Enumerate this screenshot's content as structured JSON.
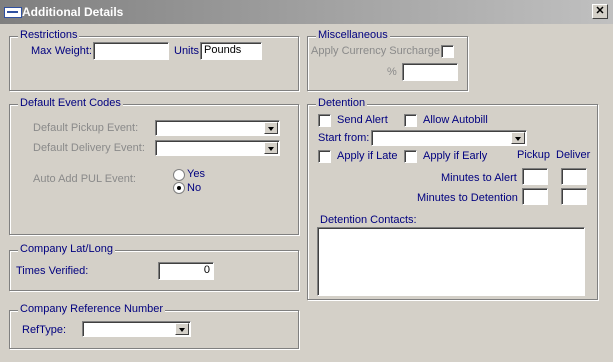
{
  "window": {
    "title": "Additional Details",
    "close_glyph": "✕"
  },
  "restrictions": {
    "legend": "Restrictions",
    "max_weight_label": "Max Weight:",
    "max_weight_value": "",
    "units_label": "Units:",
    "units_value": "Pounds"
  },
  "miscellaneous": {
    "legend": "Miscellaneous",
    "apply_currency_label": "Apply Currency Surcharge",
    "percent_label": "%",
    "percent_value": ""
  },
  "default_event_codes": {
    "legend": "Default Event Codes",
    "pickup_label": "Default Pickup Event:",
    "pickup_value": "",
    "delivery_label": "Default Delivery Event:",
    "delivery_value": "",
    "auto_add_label": "Auto Add PUL Event:",
    "yes_label": "Yes",
    "no_label": "No",
    "selected": "No"
  },
  "detention": {
    "legend": "Detention",
    "send_alert_label": "Send Alert",
    "allow_autobill_label": "Allow Autobill",
    "start_from_label": "Start from:",
    "start_from_value": "",
    "apply_if_late_label": "Apply if Late",
    "apply_if_early_label": "Apply if Early",
    "pickup_col": "Pickup",
    "delivery_col": "Deliver",
    "minutes_to_alert_label": "Minutes to Alert",
    "minutes_to_detention_label": "Minutes to Detention",
    "contacts_label": "Detention Contacts:"
  },
  "company_latlong": {
    "legend": "Company Lat/Long",
    "times_verified_label": "Times Verified:",
    "times_verified_value": "0"
  },
  "company_ref": {
    "legend": "Company Reference Number",
    "reftype_label": "RefType:",
    "reftype_value": ""
  }
}
